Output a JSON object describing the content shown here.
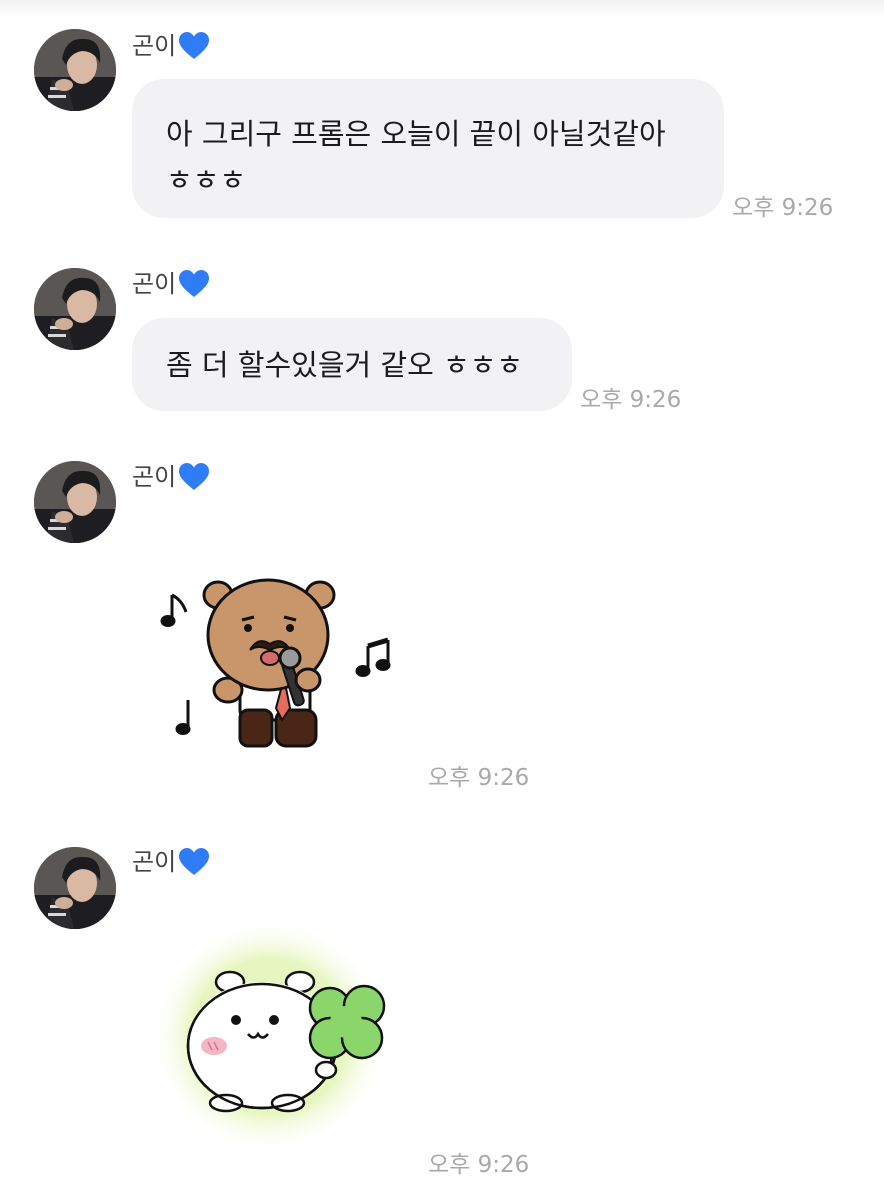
{
  "messages": [
    {
      "sender": "곤이",
      "lines": [
        "아 그리구 프롬은 오늘이 끝이 아닐것같아",
        "ㅎㅎㅎ"
      ],
      "time": "오후 9:26"
    },
    {
      "sender": "곤이",
      "lines": [
        "좀 더 할수있을거 같오 ㅎㅎㅎ"
      ],
      "time": "오후 9:26"
    },
    {
      "sender": "곤이",
      "sticker": "singing-bear-sticker",
      "time": "오후 9:26"
    },
    {
      "sender": "곤이",
      "sticker": "clover-hamster-sticker",
      "time": "오후 9:26"
    }
  ],
  "colors": {
    "bubble": "#f2f2f4",
    "heart": "#2f7df6",
    "time": "#a8a8ae"
  }
}
